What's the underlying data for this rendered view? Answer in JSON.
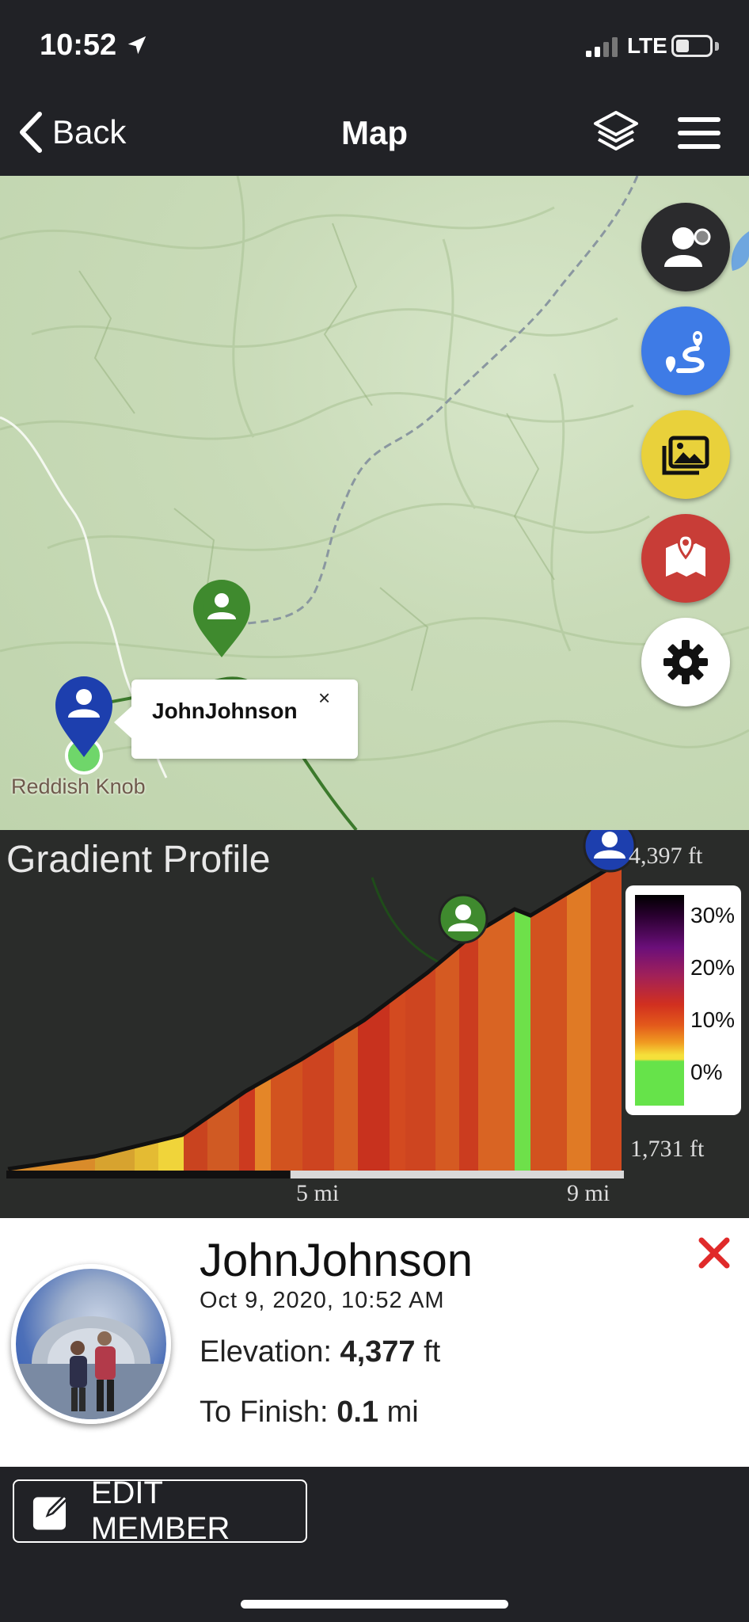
{
  "status_bar": {
    "time": "10:52",
    "network": "LTE"
  },
  "nav": {
    "back_label": "Back",
    "title": "Map"
  },
  "map": {
    "place_label": "Reddish Knob",
    "popup": {
      "name": "JohnJohnson",
      "close": "×"
    },
    "actions": [
      {
        "name": "member-view",
        "icon": "person-icon",
        "color": "#2b2b2d"
      },
      {
        "name": "route",
        "icon": "route-icon",
        "color": "#3e7be6"
      },
      {
        "name": "photos",
        "icon": "photos-icon",
        "color": "#e9d13b"
      },
      {
        "name": "map-markers",
        "icon": "map-marker-icon",
        "color": "#c83d37"
      },
      {
        "name": "settings",
        "icon": "gear-icon",
        "color": "#ffffff"
      }
    ]
  },
  "profile": {
    "title": "Gradient Profile",
    "elevation_max": "4,397 ft",
    "elevation_min": "1,731 ft",
    "distance_ticks": [
      "5 mi",
      "9 mi"
    ],
    "legend": [
      "30%",
      "20%",
      "10%",
      "0%"
    ],
    "progress_fraction": 0.46
  },
  "member": {
    "name": "JohnJohnson",
    "date": "Oct 9, 2020, 10:52 AM",
    "elevation_label": "Elevation:",
    "elevation_value": "4,377",
    "elevation_unit": "ft",
    "finish_label": "To Finish:",
    "finish_value": "0.1",
    "finish_unit": "mi"
  },
  "bottom": {
    "edit_label": "EDIT MEMBER"
  }
}
